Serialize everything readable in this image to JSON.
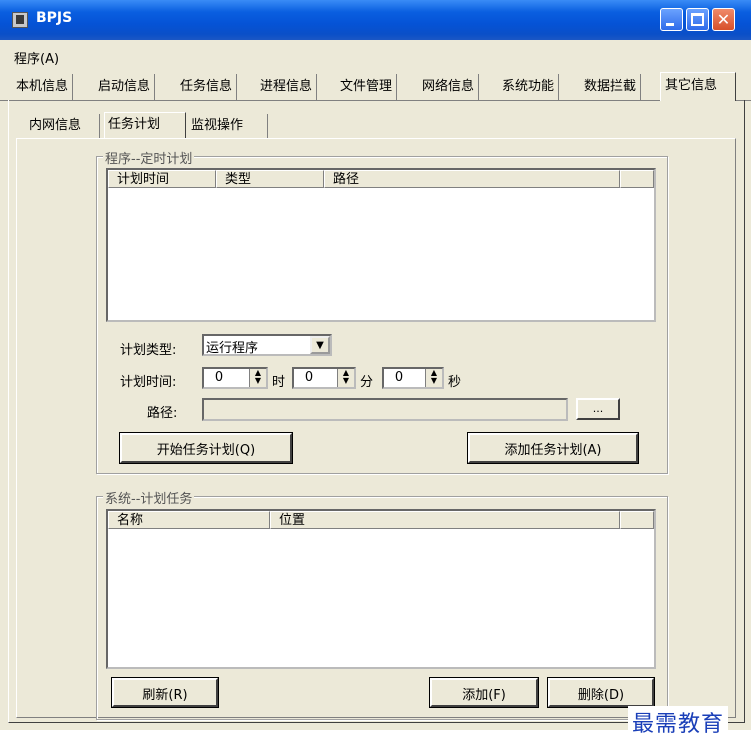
{
  "window": {
    "title": "BPJS"
  },
  "menu": {
    "program": "程序(A)"
  },
  "main_tabs": [
    "本机信息",
    "启动信息",
    "任务信息",
    "进程信息",
    "文件管理",
    "网络信息",
    "系统功能",
    "数据拦截",
    "其它信息"
  ],
  "sub_tabs": [
    "内网信息",
    "任务计划",
    "监视操作"
  ],
  "scheduled": {
    "legend": "程序--定时计划",
    "columns": [
      "计划时间",
      "类型",
      "路径"
    ],
    "type_label": "计划类型:",
    "type_value": "运行程序",
    "time_label": "计划时间:",
    "hour": "0",
    "hour_unit": "时",
    "minute": "0",
    "minute_unit": "分",
    "second": "0",
    "second_unit": "秒",
    "path_label": "路径:",
    "path_value": "",
    "browse_label": "...",
    "start_button": "开始任务计划(Q)",
    "add_button": "添加任务计划(A)"
  },
  "system_tasks": {
    "legend": "系统--计划任务",
    "columns": [
      "名称",
      "位置"
    ],
    "refresh_button": "刷新(R)",
    "add_button": "添加(F)",
    "delete_button": "删除(D)"
  },
  "watermark": "最需教育"
}
